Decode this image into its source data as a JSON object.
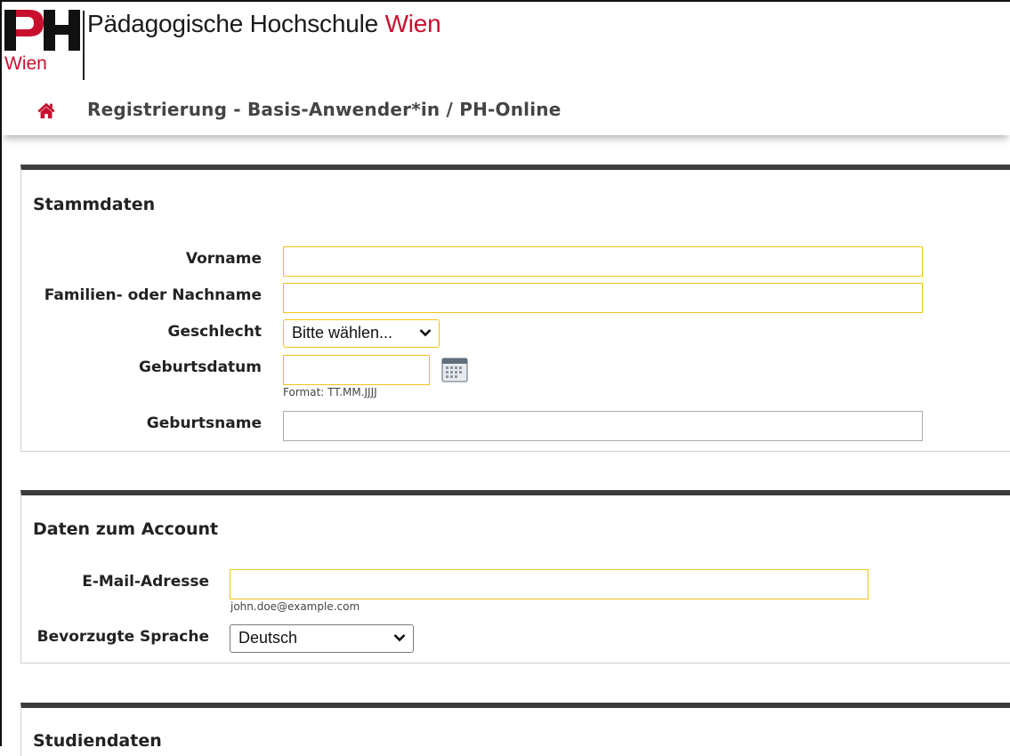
{
  "header": {
    "logo_text": "PH",
    "logo_subtext": "Wien",
    "institution_name": "Pädagogische Hochschule",
    "institution_city": "Wien",
    "breadcrumb_title": "Registrierung - Basis-Anwender*in",
    "breadcrumb_app": " / PH-Online",
    "brand_color": "#c8102e"
  },
  "stammdaten": {
    "title": "Stammdaten",
    "vorname_label": "Vorname",
    "vorname_value": "",
    "nachname_label": "Familien- oder Nachname",
    "nachname_value": "",
    "geschlecht_label": "Geschlecht",
    "geschlecht_value": "Bitte wählen...",
    "geburtsdatum_label": "Geburtsdatum",
    "geburtsdatum_value": "",
    "geburtsdatum_hint": "Format: TT.MM.JJJJ",
    "geburtsname_label": "Geburtsname",
    "geburtsname_value": ""
  },
  "account": {
    "title": "Daten zum Account",
    "email_label": "E-Mail-Adresse",
    "email_value": "",
    "email_hint": "john.doe@example.com",
    "sprache_label": "Bevorzugte Sprache",
    "sprache_value": "Deutsch"
  },
  "studiendaten": {
    "title": "Studiendaten"
  },
  "colors": {
    "required_border": "#f0c419",
    "section_rule": "#3c3c3c"
  },
  "icons": {
    "home": "home-icon",
    "calendar": "calendar-icon",
    "dropdown": "chevron-down-icon"
  }
}
